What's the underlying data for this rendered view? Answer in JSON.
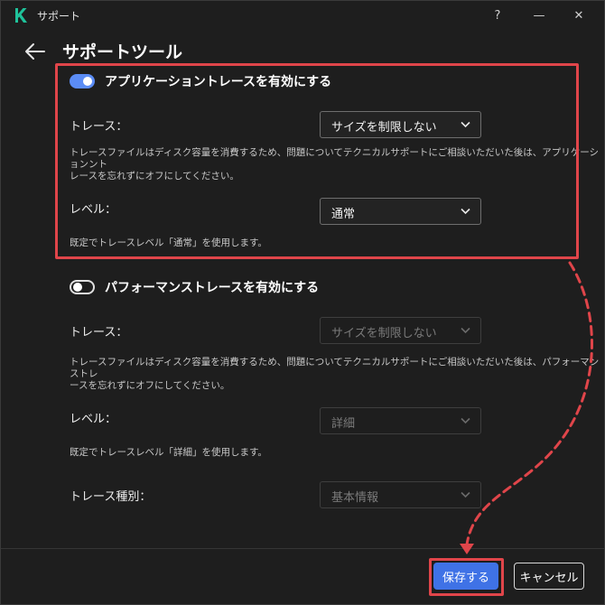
{
  "window": {
    "title": "サポート",
    "help": "?",
    "minimize": "—",
    "close": "✕"
  },
  "page": {
    "title": "サポートツール"
  },
  "app_trace": {
    "enabled": true,
    "heading": "アプリケーショントレースを有効にする",
    "trace_label": "トレース：",
    "trace_value": "サイズを制限しない",
    "trace_help_line1": "トレースファイルはディスク容量を消費するため、問題についてテクニカルサポートにご相談いただいた後は、アプリケーションント",
    "trace_help_line2": "レースを忘れずにオフにしてください。",
    "level_label": "レベル：",
    "level_value": "通常",
    "level_help": "既定でトレースレベル「通常」を使用します。"
  },
  "perf_trace": {
    "enabled": false,
    "heading": "パフォーマンストレースを有効にする",
    "trace_label": "トレース：",
    "trace_value": "サイズを制限しない",
    "trace_help_line1": "トレースファイルはディスク容量を消費するため、問題についてテクニカルサポートにご相談いただいた後は、パフォーマンストレ",
    "trace_help_line2": "ースを忘れずにオフにしてください。",
    "level_label": "レベル：",
    "level_value": "詳細",
    "level_help": "既定でトレースレベル「詳細」を使用します。",
    "type_label": "トレース種別：",
    "type_value": "基本情報"
  },
  "footer": {
    "save_label": "保存する",
    "cancel_label": "キャンセル"
  },
  "colors": {
    "accent": "#3f72e6",
    "highlight": "#e0454a"
  }
}
